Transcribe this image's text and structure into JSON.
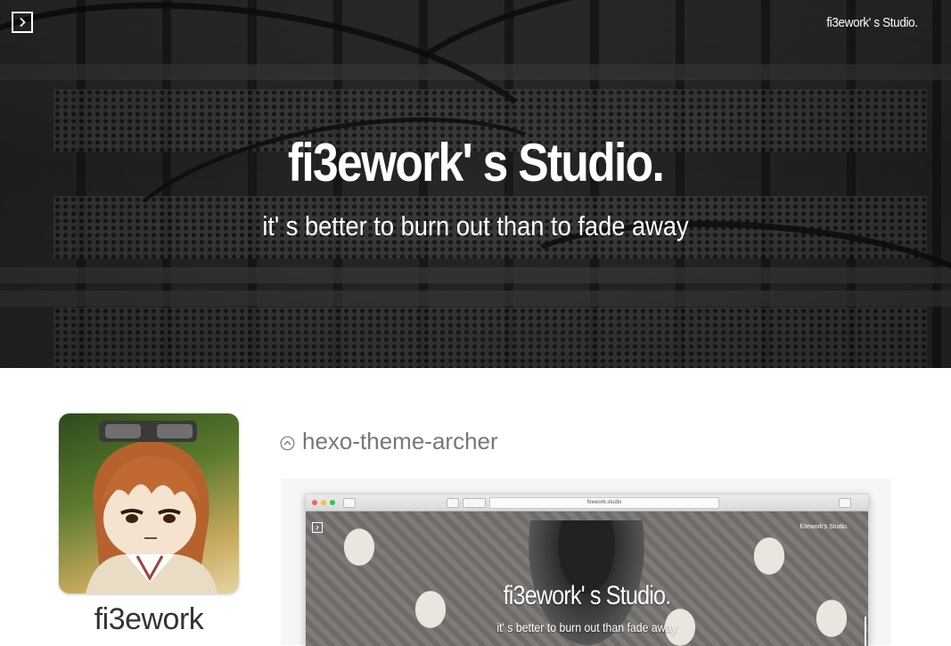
{
  "header": {
    "brand": "fi3ework' s Studio.",
    "title": "fi3ework' s Studio.",
    "subtitle": "it' s better to burn out than to fade away",
    "toggle_icon": "chevron-right-icon"
  },
  "profile": {
    "author_name": "fi3ework"
  },
  "post": {
    "title": "hexo-theme-archer",
    "title_icon": "chevron-up-circle-icon",
    "preview": {
      "url": "firework.studio",
      "brand": "fi3ework's Studio.",
      "title": "fi3ework' s Studio.",
      "subtitle": "it' s better to burn out than fade away"
    }
  }
}
